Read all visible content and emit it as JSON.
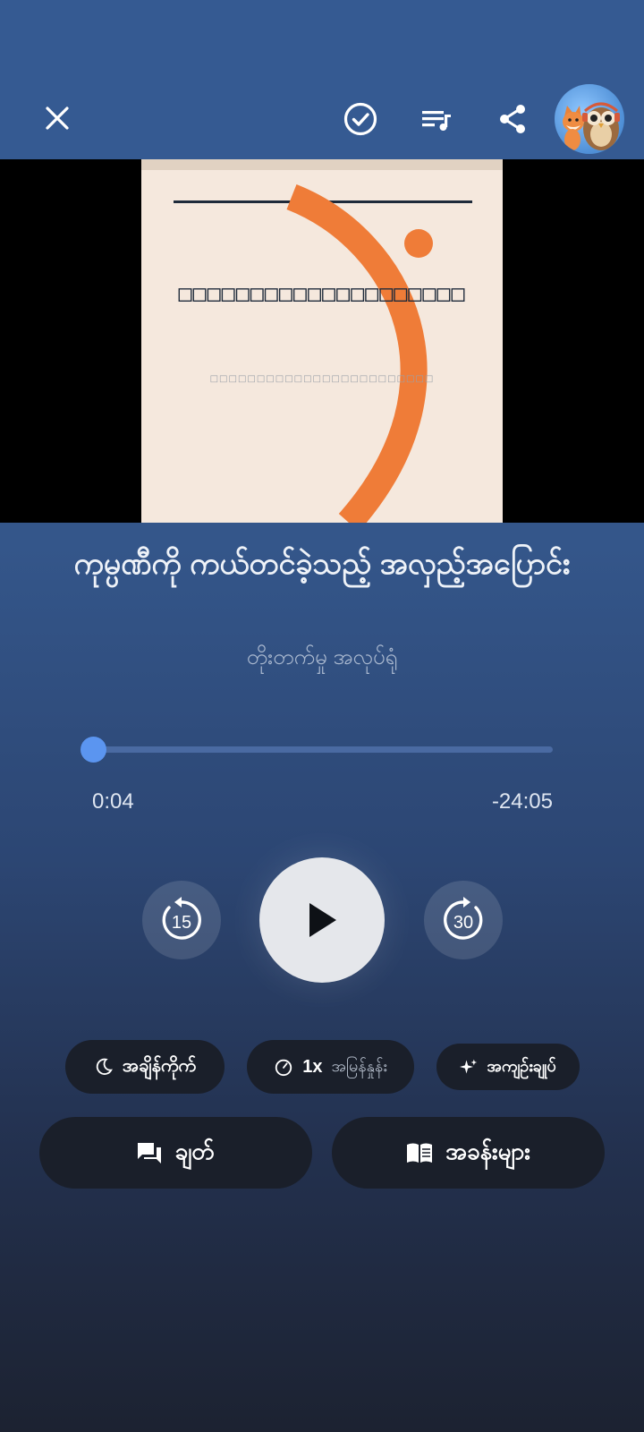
{
  "header": {
    "close_icon": "close-icon",
    "check_icon": "check-circle-icon",
    "queue_icon": "playlist-icon",
    "share_icon": "share-icon",
    "avatar": "fox-and-owl-avatar"
  },
  "cover": {
    "title": "□□□□□□□□□□□□□□□□□□□□",
    "subtitle": "□□□□□□□□□□□□□□□□□□□□□□□□",
    "accent_color": "#ef7c38",
    "background_color": "#f5e8dd"
  },
  "episode": {
    "title": "ကုမ္ပဏီကို ကယ်တင်ခဲ့သည့် အလှည့်အပြောင်း",
    "author": "တိုးတက်မှု အလုပ်ရုံ"
  },
  "player": {
    "elapsed": "0:04",
    "remaining": "-24:05",
    "progress": 0.003,
    "rewind_label": "15",
    "forward_label": "30"
  },
  "chips": {
    "sleep_timer": "အချိန်ကိုက်",
    "speed_value": "1x",
    "speed_label": "အမြန်နှုန်း",
    "summary": "အကျဉ်းချုပ်"
  },
  "actions": {
    "chat": "ချတ်",
    "chapters": "အခန်းများ"
  }
}
